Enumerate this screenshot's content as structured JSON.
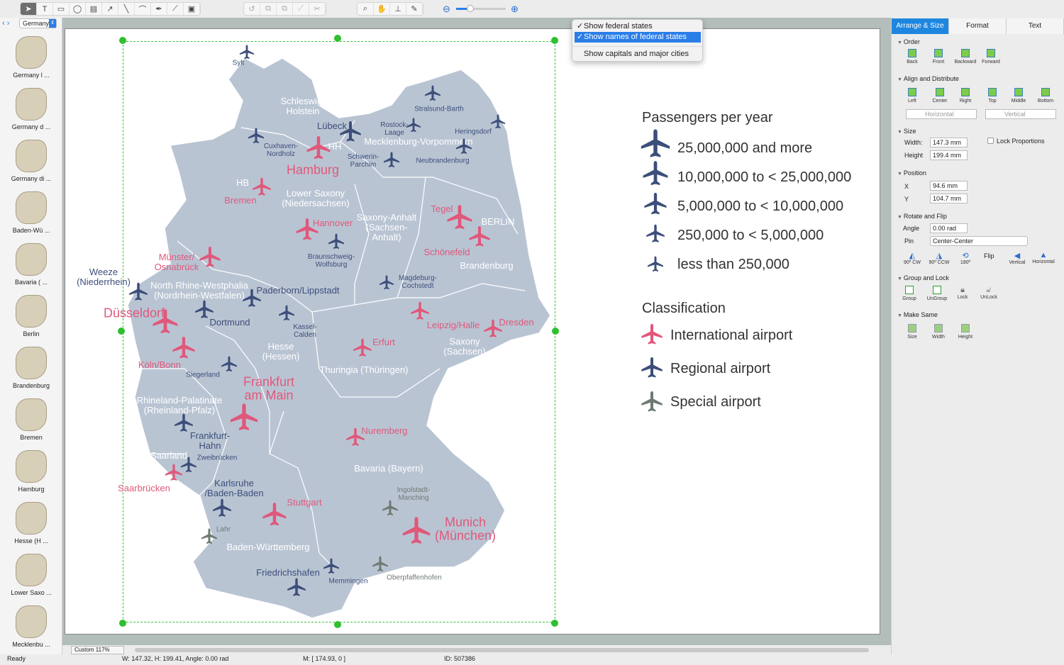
{
  "toolbar": {
    "page_selector": "Germany",
    "zoom_icons": [
      "zoom-out-icon",
      "zoom-in-icon"
    ]
  },
  "sidebar": {
    "items": [
      {
        "label": "Germany l ..."
      },
      {
        "label": "Germany d ..."
      },
      {
        "label": "Germany di ..."
      },
      {
        "label": "Baden-Wü ..."
      },
      {
        "label": "Bavaria ( ..."
      },
      {
        "label": "Berlin"
      },
      {
        "label": "Brandenburg"
      },
      {
        "label": "Bremen"
      },
      {
        "label": "Hamburg"
      },
      {
        "label": "Hesse (H ..."
      },
      {
        "label": "Lower Saxo ..."
      },
      {
        "label": "Mecklenbu ..."
      }
    ]
  },
  "context_menu": {
    "items": [
      {
        "label": "Show federal states",
        "checked": true
      },
      {
        "label": "Show names of federal states",
        "checked": true,
        "highlighted": true
      },
      {
        "label": "Show capitals and major cities",
        "checked": false
      }
    ],
    "check": "✓"
  },
  "map": {
    "states": {
      "sh": "Schleswig-\nHolstein",
      "mv": "Mecklenburg-Vorpommern",
      "ni": "Lower Saxony\n(Niedersachsen)",
      "st": "Saxony-Anhalt\n(Sachsen-\nAnhalt)",
      "bb": "Brandenburg",
      "nw": "North Rhine-Westphalia\n(Nordrhein-Westfalen)",
      "he": "Hesse\n(Hessen)",
      "th": "Thuringia (Thüringen)",
      "sn": "Saxony\n(Sachsen)",
      "rp": "Rhineland-Palatinate\n(Rheinland-Pfalz)",
      "sl": "Saarland",
      "by": "Bavaria (Bayern)",
      "bw": "Baden-Württemberg",
      "hh": "HH",
      "hb": "HB",
      "be": "BERLIN"
    },
    "regional": {
      "sylt": "Sylt",
      "stralsund": "Stralsund-Barth",
      "heringsdorf": "Heringsdorf",
      "luebeck": "Lübeck",
      "rostock": "Rostock-\nLaage",
      "cuxhaven": "Cuxhaven-\nNordholz",
      "schwerin": "Schwerin-\nParchim",
      "neubrandenburg": "Neubrandenburg",
      "braunschweig": "Braunschweig-\nWolfsburg",
      "magdeburg": "Magdeburg-\nCochstedt",
      "paderborn": "Paderborn/Lippstadt",
      "dortmund": "Dortmund",
      "kassel": "Kassel-\nCalden",
      "weeze": "Weeze\n(Niederrhein)",
      "siegerland": "Siegerland",
      "hahn": "Frankfurt-\nHahn",
      "zweibruecken": "Zweibrücken",
      "karlsruhe": "Karlsruhe\n/Baden-Baden",
      "friedrichshafen": "Friedrichshafen",
      "memmingen": "Memmingen"
    },
    "special": {
      "ingolstadt": "Ingolstadt-\nManching",
      "lahr": "Lahr",
      "oberpfaffenhofen": "Oberpfaffenhofen"
    },
    "international": {
      "hamburg": "Hamburg",
      "bremen": "Bremen",
      "hannover": "Hannover",
      "tegel": "Tegel",
      "schoenefeld": "Schönefeld",
      "muenster": "Münster/\nOsnabrück",
      "duesseldorf": "Düsseldorf",
      "leipzig": "Leipzig/Halle",
      "dresden": "Dresden",
      "erfurt": "Erfurt",
      "koeln": "Köln/Bonn",
      "frankfurt": "Frankfurt\nam Main",
      "nuremberg": "Nuremberg",
      "saarbruecken": "Saarbrücken",
      "stuttgart": "Stuttgart",
      "munich": "Munich\n(München)"
    },
    "colors": {
      "land": "#b9c4d3",
      "regional": "#3c4e7a",
      "international": "#e0587a",
      "special": "#6e7a72"
    }
  },
  "legend": {
    "title": "Passengers per year",
    "sizes": [
      "25,000,000 and more",
      "10,000,000 to < 25,000,000",
      "5,000,000 to < 10,000,000",
      "250,000 to < 5,000,000",
      "less than 250,000"
    ],
    "class_title": "Classification",
    "classes": [
      "International airport",
      "Regional airport",
      "Special airport"
    ]
  },
  "panel": {
    "tabs": [
      "Arrange & Size",
      "Format",
      "Text"
    ],
    "order": {
      "title": "Order",
      "items": [
        "Back",
        "Front",
        "Backward",
        "Forward"
      ]
    },
    "align": {
      "title": "Align and Distribute",
      "items": [
        "Left",
        "Center",
        "Right",
        "Top",
        "Middle",
        "Bottom"
      ],
      "horizontal": "Horizontal",
      "vertical": "Vertical"
    },
    "size": {
      "title": "Size",
      "width_label": "Width:",
      "width": "147.3 mm",
      "height_label": "Height",
      "height": "199.4 mm",
      "lock": "Lock Proportions"
    },
    "position": {
      "title": "Position",
      "x_label": "X",
      "x": "94.6 mm",
      "y_label": "Y",
      "y": "104.7 mm"
    },
    "rotate": {
      "title": "Rotate and Flip",
      "angle_label": "Angle",
      "angle": "0.00 rad",
      "pin_label": "Pin",
      "pin": "Center-Center",
      "items": [
        "90º CW",
        "90º CCW",
        "180º"
      ],
      "flip": "Flip",
      "flip_items": [
        "Vertical",
        "Horizontal"
      ]
    },
    "group": {
      "title": "Group and Lock",
      "items": [
        "Group",
        "UnGroup",
        "Lock",
        "UnLock"
      ]
    },
    "same": {
      "title": "Make Same",
      "items": [
        "Size",
        "Width",
        "Height"
      ]
    }
  },
  "bottom": {
    "zoom": "Custom 117%"
  },
  "status": {
    "ready": "Ready",
    "dims": "W: 147.32,  H: 199.41,  Angle: 0.00 rad",
    "mouse": "M: [ 174.93, 0 ]",
    "id": "ID: 507386"
  }
}
